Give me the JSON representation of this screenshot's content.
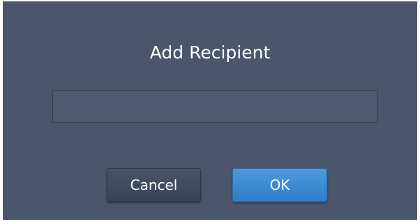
{
  "dialog": {
    "title": "Add Recipient",
    "recipient_input": {
      "value": "",
      "placeholder": ""
    },
    "buttons": {
      "cancel_label": "Cancel",
      "ok_label": "OK"
    },
    "colors": {
      "background": "#4b566c",
      "ok_accent": "#3a8ad3"
    }
  }
}
